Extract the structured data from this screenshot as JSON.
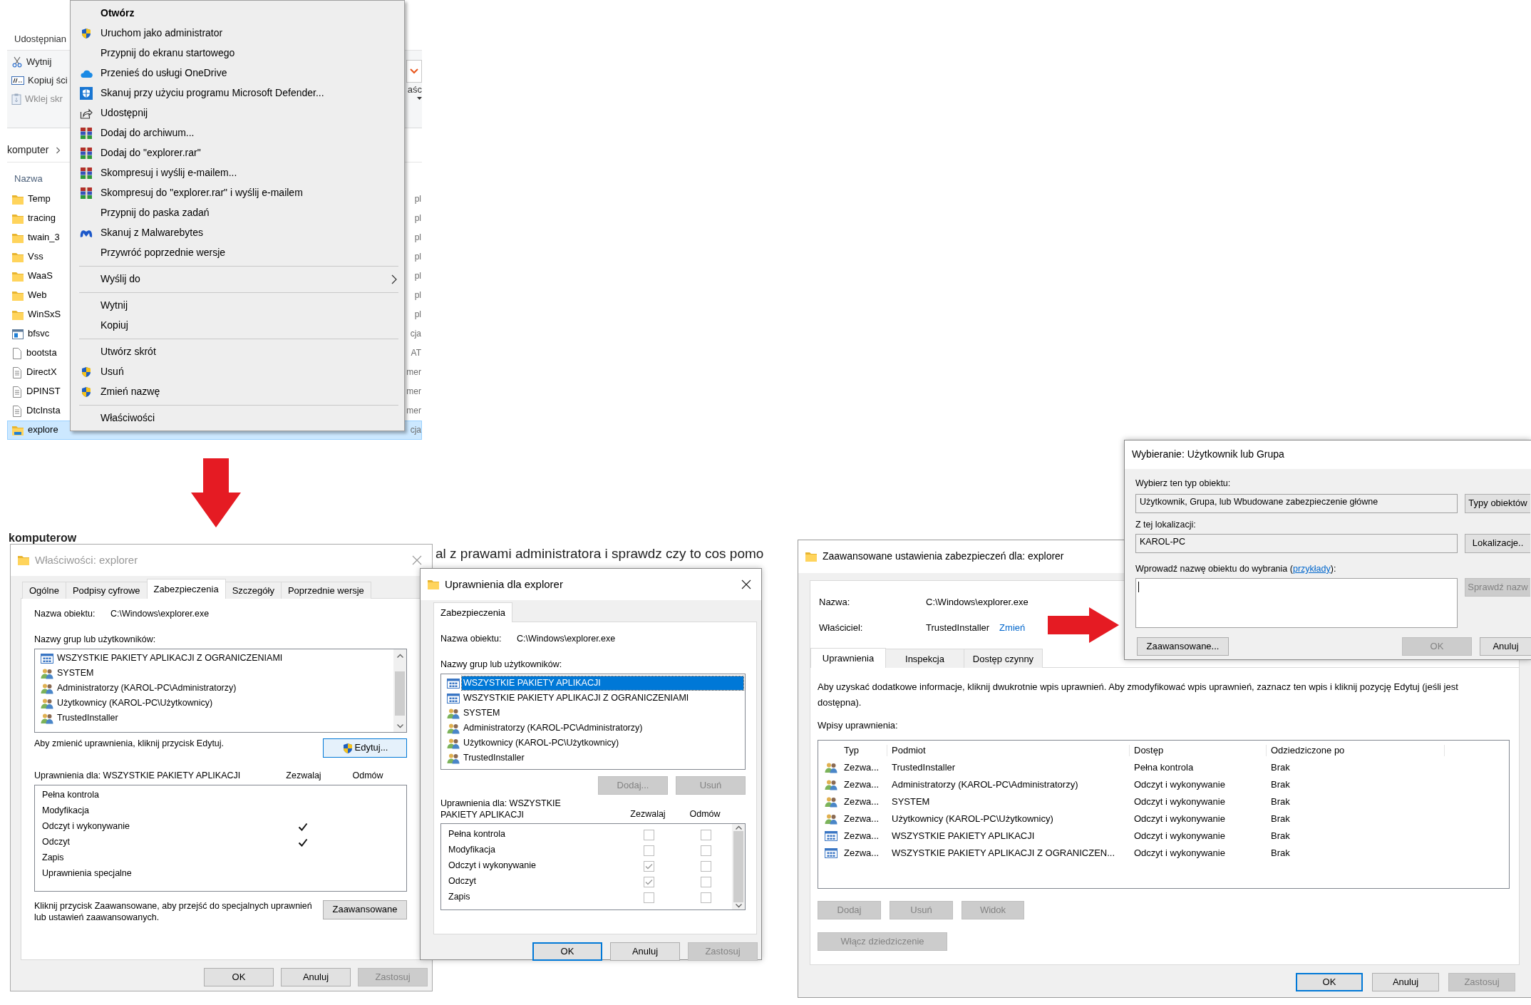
{
  "explorer": {
    "ribbon_tab": "Udostępnian",
    "ribbon_items": [
      {
        "label": "Wytnij",
        "disabled": false
      },
      {
        "label": "Kopiuj ści",
        "disabled": false
      },
      {
        "label": "Wklej skr",
        "disabled": true
      }
    ],
    "ribbon_fragment": "aśc",
    "breadcrumb": "komputer",
    "column": "Nazwa",
    "files": [
      {
        "name": "Temp",
        "kind": "folder",
        "type": "pl",
        "selected": false
      },
      {
        "name": "tracing",
        "kind": "folder",
        "type": "pl",
        "selected": false
      },
      {
        "name": "twain_3",
        "kind": "folder",
        "type": "pl",
        "selected": false
      },
      {
        "name": "Vss",
        "kind": "folder",
        "type": "pl",
        "selected": false
      },
      {
        "name": "WaaS",
        "kind": "folder",
        "type": "pl",
        "selected": false
      },
      {
        "name": "Web",
        "kind": "folder",
        "type": "pl",
        "selected": false
      },
      {
        "name": "WinSxS",
        "kind": "folder",
        "type": "pl",
        "selected": false
      },
      {
        "name": "bfsvc",
        "kind": "app",
        "type": "cja",
        "selected": false
      },
      {
        "name": "bootsta",
        "kind": "file",
        "type": "AT",
        "selected": false
      },
      {
        "name": "DirectX",
        "kind": "doc",
        "type": "mer",
        "selected": false
      },
      {
        "name": "DPINST",
        "kind": "doc",
        "type": "mer",
        "selected": false
      },
      {
        "name": "DtcInsta",
        "kind": "doc",
        "type": "mer",
        "selected": false
      },
      {
        "name": "explore",
        "kind": "explorer",
        "type": "cja",
        "selected": true
      }
    ]
  },
  "context_menu": {
    "items": [
      {
        "kind": "default",
        "label": "Otwórz"
      },
      {
        "kind": "item",
        "label": "Uruchom jako administrator"
      },
      {
        "kind": "item",
        "label": "Przypnij do ekranu startowego"
      },
      {
        "kind": "item",
        "label": "Przenieś do usługi OneDrive"
      },
      {
        "kind": "item",
        "label": "Skanuj przy użyciu programu Microsoft Defender..."
      },
      {
        "kind": "item",
        "label": "Udostępnij"
      },
      {
        "kind": "item",
        "label": "Dodaj do archiwum..."
      },
      {
        "kind": "item",
        "label": "Dodaj do \"explorer.rar\""
      },
      {
        "kind": "item",
        "label": "Skompresuj i wyślij e-mailem..."
      },
      {
        "kind": "item",
        "label": "Skompresuj do \"explorer.rar\" i wyślij e-mailem"
      },
      {
        "kind": "item",
        "label": "Przypnij do paska zadań"
      },
      {
        "kind": "item",
        "label": "Skanuj z Malwarebytes"
      },
      {
        "kind": "item",
        "label": "Przywróć poprzednie wersje"
      },
      {
        "kind": "separator"
      },
      {
        "kind": "submenu",
        "label": "Wyślij do"
      },
      {
        "kind": "separator"
      },
      {
        "kind": "item",
        "label": "Wytnij"
      },
      {
        "kind": "item",
        "label": "Kopiuj"
      },
      {
        "kind": "separator"
      },
      {
        "kind": "item",
        "label": "Utwórz skrót"
      },
      {
        "kind": "item",
        "label": "Usuń"
      },
      {
        "kind": "item",
        "label": "Zmień nazwę"
      },
      {
        "kind": "separator"
      },
      {
        "kind": "item",
        "label": "Właściwości"
      }
    ]
  },
  "background_texts": {
    "heading_fragment": "komputerow",
    "comment_fragment": "al z prawami administratora i sprawdz czy to cos pomo"
  },
  "properties_dialog": {
    "title": "Właściwości: explorer",
    "active": false,
    "tabs": [
      {
        "label": "Ogólne",
        "selected": false
      },
      {
        "label": "Podpisy cyfrowe",
        "selected": false
      },
      {
        "label": "Zabezpieczenia",
        "selected": true
      },
      {
        "label": "Szczegóły",
        "selected": false
      },
      {
        "label": "Poprzednie wersje",
        "selected": false
      }
    ],
    "object_label": "Nazwa obiektu:",
    "object_value": "C:\\Windows\\explorer.exe",
    "groups_label": "Nazwy grup lub użytkowników:",
    "groups": [
      {
        "name": "WSZYSTKIE PAKIETY APLIKACJI Z OGRANICZENIAMI",
        "kind": "package",
        "selected": false
      },
      {
        "name": "SYSTEM",
        "kind": "users",
        "selected": false
      },
      {
        "name": "Administratorzy (KAROL-PC\\Administratorzy)",
        "kind": "users",
        "selected": false
      },
      {
        "name": "Użytkownicy (KAROL-PC\\Użytkownicy)",
        "kind": "users",
        "selected": false
      },
      {
        "name": "TrustedInstaller",
        "kind": "users",
        "selected": false
      }
    ],
    "edit_hint": "Aby zmienić uprawnienia, kliknij przycisk Edytuj.",
    "edit_button": "Edytuj...",
    "permissions_label": "Uprawnienia dla: WSZYSTKIE PAKIETY APLIKACJI",
    "allow_label": "Zezwalaj",
    "deny_label": "Odmów",
    "permissions": [
      {
        "name": "Pełna kontrola",
        "allow": false,
        "deny": false
      },
      {
        "name": "Modyfikacja",
        "allow": false,
        "deny": false
      },
      {
        "name": "Odczyt i wykonywanie",
        "allow": true,
        "deny": false
      },
      {
        "name": "Odczyt",
        "allow": true,
        "deny": false
      },
      {
        "name": "Zapis",
        "allow": false,
        "deny": false
      },
      {
        "name": "Uprawnienia specjalne",
        "allow": false,
        "deny": false
      }
    ],
    "advanced_hint": "Kliknij przycisk Zaawansowane, aby przejść do specjalnych uprawnień lub ustawień zaawansowanych.",
    "advanced_button": "Zaawansowane",
    "buttons": [
      {
        "label": "OK",
        "disabled": false,
        "default": false
      },
      {
        "label": "Anuluj",
        "disabled": false,
        "default": false
      },
      {
        "label": "Zastosuj",
        "disabled": true,
        "default": false
      }
    ]
  },
  "permissions_dialog": {
    "title": "Uprawnienia dla explorer",
    "active": true,
    "tabs": [
      {
        "label": "Zabezpieczenia",
        "selected": true
      }
    ],
    "object_label": "Nazwa obiektu:",
    "object_value": "C:\\Windows\\explorer.exe",
    "groups_label": "Nazwy grup lub użytkowników:",
    "groups": [
      {
        "name": "WSZYSTKIE PAKIETY APLIKACJI",
        "kind": "package",
        "selected": true
      },
      {
        "name": "WSZYSTKIE PAKIETY APLIKACJI Z OGRANICZENIAMI",
        "kind": "package",
        "selected": false
      },
      {
        "name": "SYSTEM",
        "kind": "users",
        "selected": false
      },
      {
        "name": "Administratorzy (KAROL-PC\\Administratorzy)",
        "kind": "users",
        "selected": false
      },
      {
        "name": "Użytkownicy (KAROL-PC\\Użytkownicy)",
        "kind": "users",
        "selected": false
      },
      {
        "name": "TrustedInstaller",
        "kind": "users",
        "selected": false
      }
    ],
    "group_buttons": [
      {
        "label": "Dodaj...",
        "disabled": true
      },
      {
        "label": "Usuń",
        "disabled": true
      }
    ],
    "permissions_label": "Uprawnienia dla: WSZYSTKIE PAKIETY APLIKACJI",
    "allow_label": "Zezwalaj",
    "deny_label": "Odmów",
    "permissions": [
      {
        "name": "Pełna kontrola",
        "allow": false,
        "deny": false
      },
      {
        "name": "Modyfikacja",
        "allow": false,
        "deny": false
      },
      {
        "name": "Odczyt i wykonywanie",
        "allow": true,
        "deny": false
      },
      {
        "name": "Odczyt",
        "allow": true,
        "deny": false
      },
      {
        "name": "Zapis",
        "allow": false,
        "deny": false
      }
    ],
    "buttons": [
      {
        "label": "OK",
        "disabled": false,
        "default": true
      },
      {
        "label": "Anuluj",
        "disabled": false,
        "default": false
      },
      {
        "label": "Zastosuj",
        "disabled": true,
        "default": false
      }
    ]
  },
  "advanced_dialog": {
    "title": "Zaawansowane ustawienia zabezpieczeń dla: explorer",
    "active": true,
    "name_label": "Nazwa:",
    "name_value": "C:\\Windows\\explorer.exe",
    "owner_label": "Właściciel:",
    "owner_value": "TrustedInstaller",
    "owner_link": "Zmień",
    "tabs": [
      {
        "label": "Uprawnienia",
        "selected": true
      },
      {
        "label": "Inspekcja",
        "selected": false
      },
      {
        "label": "Dostęp czynny",
        "selected": false
      }
    ],
    "description": "Aby uzyskać dodatkowe informacje, kliknij dwukrotnie wpis uprawnień. Aby zmodyfikować wpis uprawnień, zaznacz ten wpis i kliknij pozycję Edytuj (jeśli jest dostępna).",
    "entries_label": "Wpisy uprawnienia:",
    "columns": [
      "Typ",
      "Podmiot",
      "Dostęp",
      "Odziedziczone po"
    ],
    "entries": [
      {
        "kind": "users",
        "type": "Zezwa...",
        "principal": "TrustedInstaller",
        "access": "Pełna kontrola",
        "inherited": "Brak"
      },
      {
        "kind": "users",
        "type": "Zezwa...",
        "principal": "Administratorzy (KAROL-PC\\Administratorzy)",
        "access": "Odczyt i wykonywanie",
        "inherited": "Brak"
      },
      {
        "kind": "users",
        "type": "Zezwa...",
        "principal": "SYSTEM",
        "access": "Odczyt i wykonywanie",
        "inherited": "Brak"
      },
      {
        "kind": "users",
        "type": "Zezwa...",
        "principal": "Użytkownicy (KAROL-PC\\Użytkownicy)",
        "access": "Odczyt i wykonywanie",
        "inherited": "Brak"
      },
      {
        "kind": "package",
        "type": "Zezwa...",
        "principal": "WSZYSTKIE PAKIETY APLIKACJI",
        "access": "Odczyt i wykonywanie",
        "inherited": "Brak"
      },
      {
        "kind": "package",
        "type": "Zezwa...",
        "principal": "WSZYSTKIE PAKIETY APLIKACJI Z OGRANICZEN...",
        "access": "Odczyt i wykonywanie",
        "inherited": "Brak"
      }
    ],
    "entry_buttons": [
      {
        "label": "Dodaj",
        "disabled": true
      },
      {
        "label": "Usuń",
        "disabled": true
      },
      {
        "label": "Widok",
        "disabled": true
      }
    ],
    "inheritance_button": {
      "label": "Włącz dziedziczenie",
      "disabled": true
    },
    "buttons": [
      {
        "label": "OK",
        "disabled": false,
        "default": true
      },
      {
        "label": "Anuluj",
        "disabled": false,
        "default": false
      },
      {
        "label": "Zastosuj",
        "disabled": true,
        "default": false
      }
    ]
  },
  "select_dialog": {
    "title": "Wybieranie: Użytkownik lub Grupa",
    "active": true,
    "type_label": "Wybierz ten typ obiektu:",
    "type_value": "Użytkownik, Grupa, lub Wbudowane zabezpieczenie główne",
    "type_button": {
      "label": "Typy obiektów",
      "disabled": false
    },
    "location_label": "Z tej lokalizacji:",
    "location_value": "KAROL-PC",
    "location_button": {
      "label": "Lokalizacje..",
      "disabled": false
    },
    "name_label_start": "Wprowadź nazwę obiektu do wybrania (",
    "name_link": "przykłady",
    "name_label_end": "):",
    "check_button": {
      "label": "Sprawdź nazw",
      "disabled": true
    },
    "buttons": [
      {
        "label": "Zaawansowane...",
        "disabled": false
      },
      {
        "label": "OK",
        "disabled": true
      },
      {
        "label": "Anuluj",
        "disabled": false
      }
    ]
  }
}
